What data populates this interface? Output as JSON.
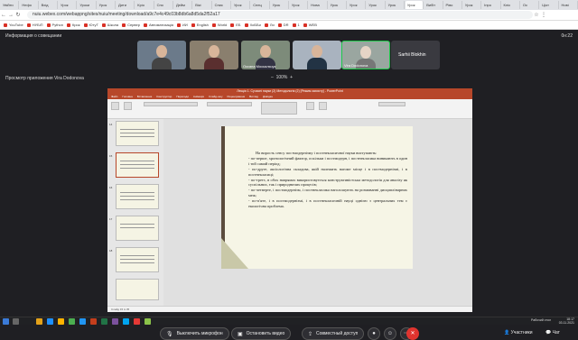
{
  "browser": {
    "tabs": [
      "Увійти",
      "Нефо",
      "Вхід",
      "Урок",
      "Уроки",
      "Урок",
      "Дити",
      "Кріо",
      "Спо",
      "Дейм",
      "Вікі",
      "Спис",
      "Урок",
      "Спец",
      "Урок",
      "Урок",
      "Нова",
      "Урок",
      "Урок",
      "Урок",
      "Урок",
      "Урок",
      "Вибіт",
      "Ріво",
      "Урок",
      "Інро",
      "Кліс",
      "Ос",
      "Ціот",
      "Нові"
    ],
    "active_tab": 21,
    "url": "nuiu.webex.com/webappng/sites/nuiu/meeting/download/a9c7e4c49c03b8db6a8d5da2f52a17",
    "bookmarks": [
      "YouTube",
      "НУБіП",
      "Python",
      "Крок",
      "ЮтуТ",
      "Школа",
      "Сервер",
      "Автоматизація",
      "ИИ",
      "English",
      "World",
      "ЕБ",
      "ХоББи",
      "Ли",
      "DR",
      "1",
      "WEB"
    ]
  },
  "meeting": {
    "info_label": "Информация о совещании",
    "time": "0н:22",
    "sharing_label": "Просмотр приложения Vira Dodonova",
    "zoom": "100%",
    "participants": [
      {
        "name": "",
        "muted": true
      },
      {
        "name": "",
        "muted": true
      },
      {
        "name": "Оксана Москальчук",
        "muted": true
      },
      {
        "name": "",
        "muted": true
      },
      {
        "name": "Vira Dodonova",
        "muted": false
      },
      {
        "name": "Sarhii Blokhin",
        "muted": true
      }
    ],
    "controls": {
      "mute": "Выключить микрофон",
      "video": "Остановить видео",
      "share": "Совместный доступ",
      "participants": "Участники",
      "chat": "Чат"
    }
  },
  "ppt": {
    "title": "Лекція 1. Сучасні науки (2) Методологія (2) [Режим захисту] - PowerPoint",
    "tabs": [
      "Файл",
      "Головна",
      "Вставлення",
      "Конструктор",
      "Переходи",
      "Анімація",
      "Слайд-шоу",
      "Рецензування",
      "Вигляд",
      "Довідка"
    ],
    "status": "Слайд 15 із 35",
    "slide_text": [
      "На вирость сенсу постмодернізму і постнекласичної науки виступають:",
      "- по-перше, хронологічний фактор, оскільки і постмодерн, і постнекласика виникають в один і той самий період;",
      "- по-друге, аксіологічна складова, якій належить вагоме місце і в постмодернізмі, і в постнекласиці;",
      "- по-третє, в обох напрямах використовується конструктивістська методологія для аналізу як суспільних, так і природничих процесів;",
      "- по-четверте, і постмодернізм, і постнекласика наголошують на розмиванні дисциплінарних меж;",
      "- по-п'яте, і в постмодернізмі, і в постнекласичній науці однією з центральних тем є екологічна проблема."
    ]
  },
  "taskbar": {
    "tray": "Рабочий стол",
    "time": "18:17",
    "date": "03.11.2021"
  }
}
